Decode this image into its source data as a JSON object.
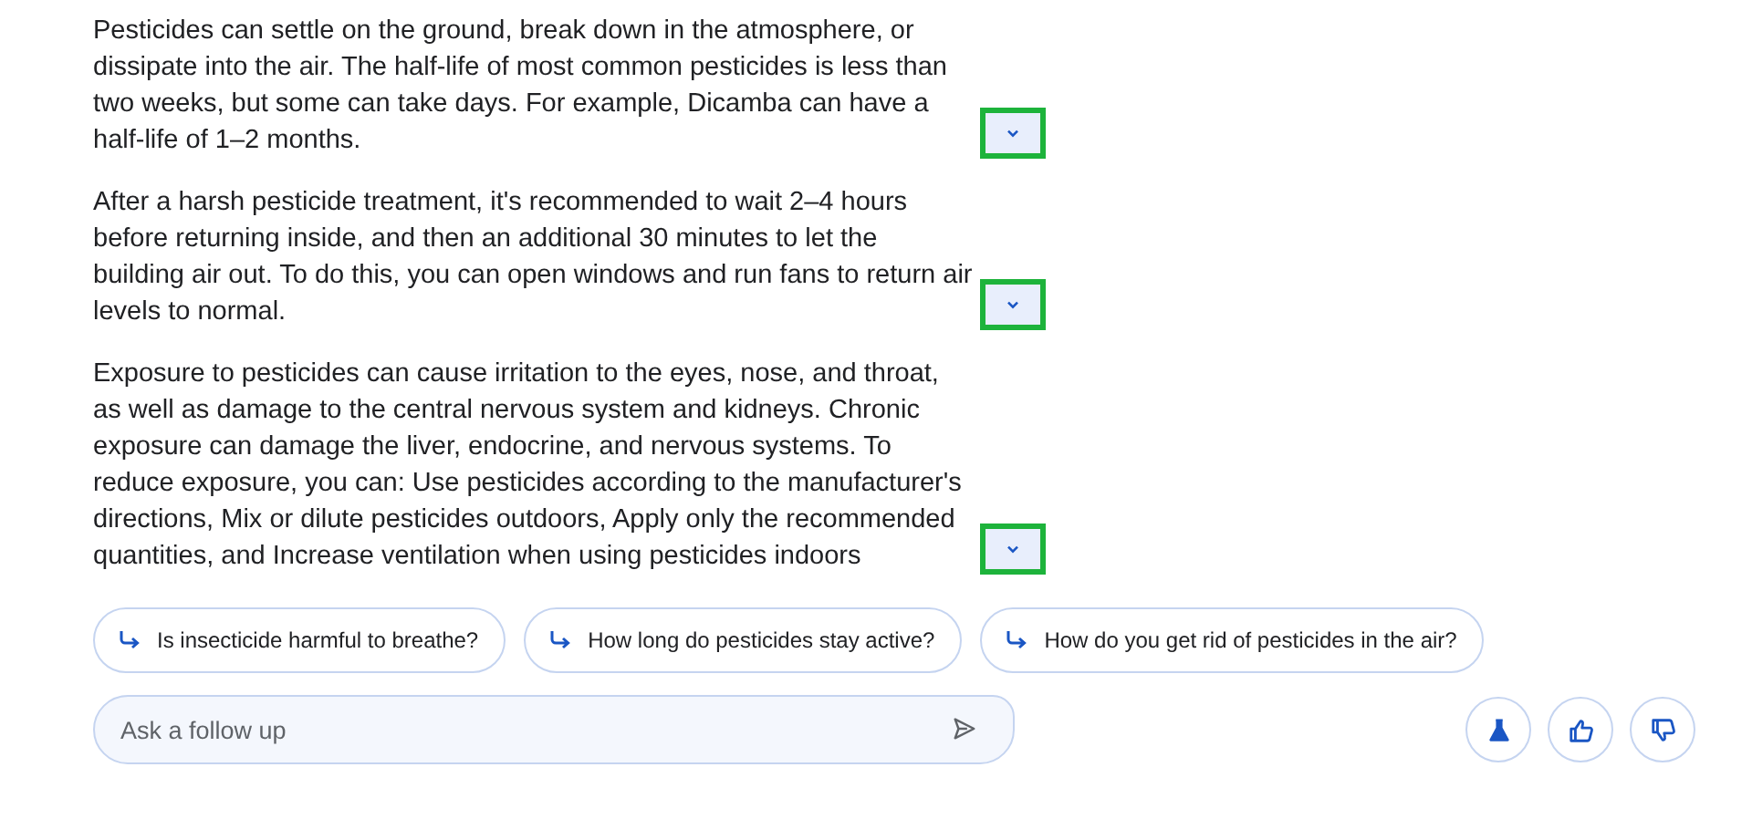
{
  "paragraphs": [
    {
      "text": "Pesticides can settle on the ground, break down in the atmosphere, or dissipate into the air. The half-life of most common pesticides is less than two weeks, but some can take days. For example, Dicamba can have a half-life of 1–2 months.",
      "highlighted": true
    },
    {
      "text": "After a harsh pesticide treatment, it's recommended to wait 2–4 hours before returning inside, and then an additional 30 minutes to let the building air out. To do this, you can open windows and run fans to return air levels to normal.",
      "highlighted": true
    },
    {
      "text": "Exposure to pesticides can cause irritation to the eyes, nose, and throat, as well as damage to the central nervous system and kidneys. Chronic exposure can damage the liver, endocrine, and nervous systems. To reduce exposure, you can: Use pesticides according to the manufacturer's directions, Mix or dilute pesticides outdoors, Apply only the recommended quantities, and Increase ventilation when using pesticides indoors",
      "highlighted": true
    }
  ],
  "suggestions": [
    "Is insecticide harmful to breathe?",
    "How long do pesticides stay active?",
    "How do you get rid of pesticides in the air?"
  ],
  "follow_up": {
    "placeholder": "Ask a follow up"
  },
  "actions": [
    {
      "kind": "labs"
    },
    {
      "kind": "thumbs_up"
    },
    {
      "kind": "thumbs_down"
    }
  ]
}
